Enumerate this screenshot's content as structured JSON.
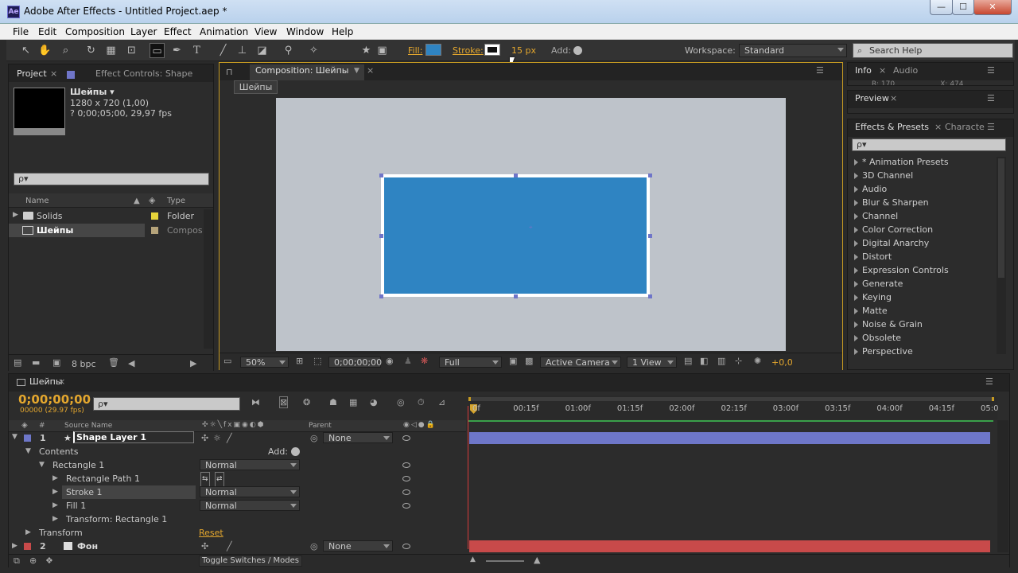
{
  "window": {
    "title": "Adobe After Effects - Untitled Project.aep *",
    "app_icon": "Ae",
    "min": "—",
    "max": "☐",
    "close": "✕"
  },
  "menu": [
    "File",
    "Edit",
    "Composition",
    "Layer",
    "Effect",
    "Animation",
    "View",
    "Window",
    "Help"
  ],
  "toolbar": {
    "fill_label": "Fill:",
    "stroke_label": "Stroke:",
    "stroke_width": "15 px",
    "add_label": "Add:",
    "workspace_label": "Workspace:",
    "workspace_value": "Standard",
    "search_help": "Search Help",
    "fill_color": "#2f84c2"
  },
  "project": {
    "tab_project": "Project",
    "tab_effect_controls": "Effect Controls: Shape",
    "item_name": "Шейпы ▾",
    "item_size": "1280 x 720 (1,00)",
    "item_duration": "? 0;00;05;00, 29,97 fps",
    "search_placeholder": "ρ▾",
    "col_name": "Name",
    "col_type": "Type",
    "rows": [
      {
        "name": "Solids",
        "type": "Folder",
        "color": "#e6d43a"
      },
      {
        "name": "Шейпы",
        "type": "Compos",
        "color": "#b5a37a"
      }
    ],
    "bpc": "8 bpc"
  },
  "composition": {
    "tab": "Composition: Шейпы",
    "crumb": "Шейпы",
    "zoom": "50%",
    "timecode": "0;00;00;00",
    "resolution": "Full",
    "camera": "Active Camera",
    "views": "1 View",
    "exposure": "+0,0",
    "shape_color": "#2f84c2",
    "canvas_color": "#bec3ca"
  },
  "right_panels": {
    "info_tab": "Info",
    "audio_tab": "Audio",
    "info_partial": "R: 170                    X: 474",
    "preview_tab": "Preview",
    "effects_tab": "Effects & Presets",
    "character_tab": "Characte",
    "effects_search": "ρ▾",
    "effects": [
      "* Animation Presets",
      "3D Channel",
      "Audio",
      "Blur & Sharpen",
      "Channel",
      "Color Correction",
      "Digital Anarchy",
      "Distort",
      "Expression Controls",
      "Generate",
      "Keying",
      "Matte",
      "Noise & Grain",
      "Obsolete",
      "Perspective"
    ]
  },
  "timeline": {
    "tab": "Шейпы",
    "timecode": "0;00;00;00",
    "fps": "00000 (29.97 fps)",
    "search_placeholder": "ρ▾",
    "col_num": "#",
    "col_source": "Source Name",
    "col_parent": "Parent",
    "ticks": [
      "0f",
      "00:15f",
      "01:00f",
      "01:15f",
      "02:00f",
      "02:15f",
      "03:00f",
      "03:15f",
      "04:00f",
      "04:15f",
      "05:0"
    ],
    "layer1": {
      "num": "1",
      "name": "Shape Layer 1",
      "parent": "None",
      "color": "#6e77c9"
    },
    "contents": "Contents",
    "add": "Add:",
    "rect": "Rectangle 1",
    "rect_mode": "Normal",
    "rect_path": "Rectangle Path 1",
    "stroke": "Stroke 1",
    "stroke_mode": "Normal",
    "fill": "Fill 1",
    "fill_mode": "Normal",
    "transform_rect": "Transform: Rectangle 1",
    "transform": "Transform",
    "reset": "Reset",
    "layer2": {
      "num": "2",
      "name": "Фон",
      "parent": "None",
      "color": "#c84a4a"
    },
    "toggle": "Toggle Switches / Modes"
  }
}
